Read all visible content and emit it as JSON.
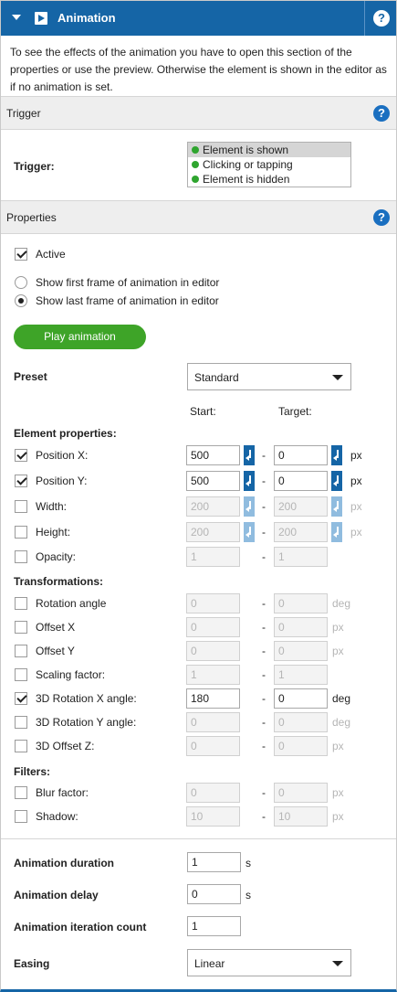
{
  "header": {
    "title": "Animation",
    "help": "?"
  },
  "description": "To see the effects of the animation you have to open this section of the properties or use the preview. Otherwise the element is shown in the editor as if no animation is set.",
  "trigger_section": {
    "title": "Trigger",
    "help": "?",
    "label": "Trigger:",
    "options": [
      "Element is shown",
      "Clicking or tapping",
      "Element is hidden"
    ],
    "selected": "Element is shown"
  },
  "properties_section": {
    "title": "Properties",
    "help": "?",
    "active_label": "Active",
    "radio_first": "Show first frame of animation in editor",
    "radio_last": "Show last frame of animation in editor",
    "play_button": "Play animation",
    "preset_label": "Preset",
    "preset_value": "Standard",
    "start_header": "Start:",
    "target_header": "Target:",
    "dash": "-"
  },
  "element_properties": {
    "title": "Element properties:",
    "rows": [
      {
        "label": "Position X:",
        "checked": true,
        "start": "500",
        "target": "0",
        "unit": "px"
      },
      {
        "label": "Position Y:",
        "checked": true,
        "start": "500",
        "target": "0",
        "unit": "px"
      },
      {
        "label": "Width:",
        "checked": false,
        "start": "200",
        "target": "200",
        "unit": "px"
      },
      {
        "label": "Height:",
        "checked": false,
        "start": "200",
        "target": "200",
        "unit": "px"
      },
      {
        "label": "Opacity:",
        "checked": false,
        "start": "1",
        "target": "1",
        "unit": ""
      }
    ]
  },
  "transformations": {
    "title": "Transformations:",
    "rows": [
      {
        "label": "Rotation angle",
        "checked": false,
        "start": "0",
        "target": "0",
        "unit": "deg"
      },
      {
        "label": "Offset X",
        "checked": false,
        "start": "0",
        "target": "0",
        "unit": "px"
      },
      {
        "label": "Offset Y",
        "checked": false,
        "start": "0",
        "target": "0",
        "unit": "px"
      },
      {
        "label": "Scaling factor:",
        "checked": false,
        "start": "1",
        "target": "1",
        "unit": ""
      },
      {
        "label": "3D Rotation X angle:",
        "checked": true,
        "start": "180",
        "target": "0",
        "unit": "deg"
      },
      {
        "label": "3D Rotation Y angle:",
        "checked": false,
        "start": "0",
        "target": "0",
        "unit": "deg"
      },
      {
        "label": "3D Offset Z:",
        "checked": false,
        "start": "0",
        "target": "0",
        "unit": "px"
      }
    ]
  },
  "filters": {
    "title": "Filters:",
    "rows": [
      {
        "label": "Blur factor:",
        "checked": false,
        "start": "0",
        "target": "0",
        "unit": "px"
      },
      {
        "label": "Shadow:",
        "checked": false,
        "start": "10",
        "target": "10",
        "unit": "px"
      }
    ]
  },
  "timing": {
    "duration_label": "Animation duration",
    "duration_value": "1",
    "duration_unit": "s",
    "delay_label": "Animation delay",
    "delay_value": "0",
    "delay_unit": "s",
    "iteration_label": "Animation iteration count",
    "iteration_value": "1",
    "easing_label": "Easing",
    "easing_value": "Linear"
  },
  "colors": {
    "header_bg": "#1565a6",
    "play_button": "#3ea428",
    "trigger_dot": "#2fa52f"
  }
}
